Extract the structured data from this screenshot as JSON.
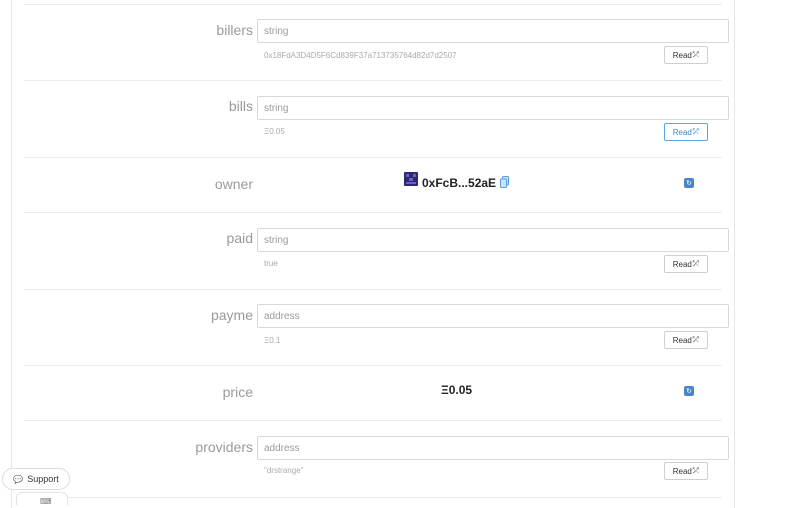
{
  "functions": [
    {
      "name": "billers",
      "placeholder": "string",
      "result": "0x18FdA3D4D5F6Cd839F37a713735764d82d7d2507",
      "read_label": "Read"
    },
    {
      "name": "bills",
      "placeholder": "string",
      "result": "Ξ0.05",
      "read_label": "Read"
    },
    {
      "name": "owner",
      "value": "0xFcB...52aE"
    },
    {
      "name": "paid",
      "placeholder": "string",
      "result": "true",
      "read_label": "Read"
    },
    {
      "name": "payme",
      "placeholder": "address",
      "result": "Ξ0.1",
      "read_label": "Read"
    },
    {
      "name": "price",
      "value": "Ξ0.05"
    },
    {
      "name": "providers",
      "placeholder": "address",
      "result": "\"drstrange\"",
      "read_label": "Read"
    }
  ],
  "support": {
    "label": "Support"
  },
  "colors": {
    "accent": "#3d8bd1",
    "refresh": "#4a86c8"
  }
}
